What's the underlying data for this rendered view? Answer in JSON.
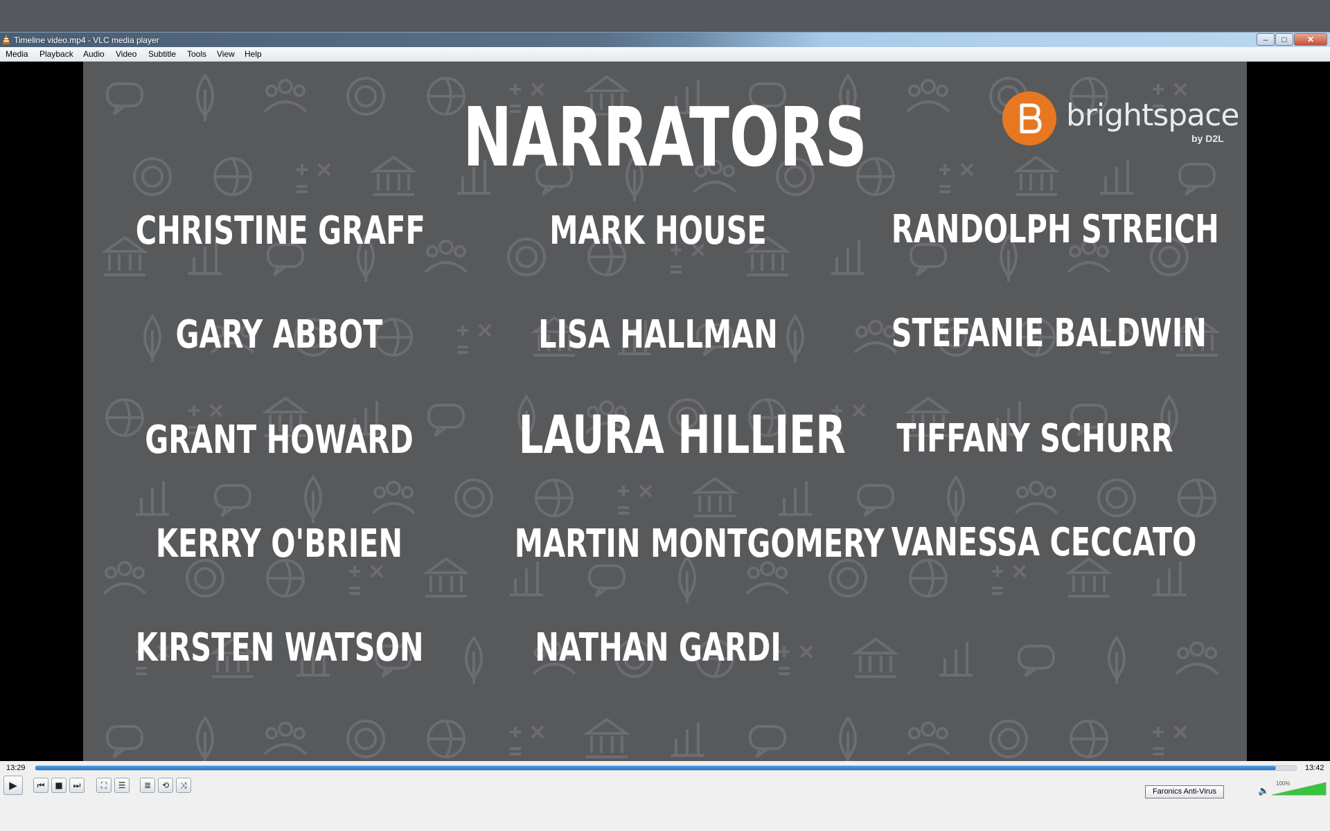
{
  "window": {
    "title": "Timeline video.mp4 - VLC media player",
    "controls": {
      "minimize": "–",
      "maximize": "□",
      "close": "✕"
    }
  },
  "menu": [
    "Media",
    "Playback",
    "Audio",
    "Video",
    "Subtitle",
    "Tools",
    "View",
    "Help"
  ],
  "slide": {
    "heading": "NARRATORS",
    "logo": {
      "word": "brightspace",
      "sub": "by D2L",
      "mark_color": "#e87722"
    },
    "names": [
      [
        "CHRISTINE GRAFF",
        "MARK HOUSE",
        "RANDOLPH STREICH"
      ],
      [
        "GARY ABBOT",
        "LISA HALLMAN",
        "STEFANIE BALDWIN"
      ],
      [
        "GRANT HOWARD",
        "LAURA HILLIER",
        "TIFFANY SCHURR"
      ],
      [
        "KERRY O'BRIEN",
        "MARTIN MONTGOMERY",
        "VANESSA CECCATO"
      ],
      [
        "KIRSTEN WATSON",
        "NATHAN GARDI",
        ""
      ]
    ],
    "background_color": "#58595b"
  },
  "player": {
    "time_elapsed": "13:29",
    "time_total": "13:42",
    "progress_fraction": 0.984,
    "buttons": {
      "play": "▶",
      "prev": "⏮",
      "stop": "■",
      "next": "⏭",
      "fullscreen": "⛶",
      "extended": "☰",
      "playlist": "≣",
      "loop": "⟲",
      "random": "⤨"
    },
    "tooltip": "Faronics Anti-Virus",
    "volume_label": "100%",
    "volume_fraction": 1.0,
    "volume_icon": "🔈"
  }
}
